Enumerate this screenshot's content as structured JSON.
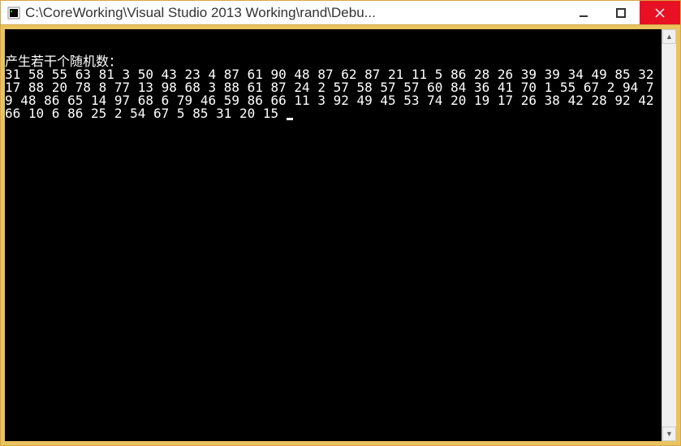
{
  "window": {
    "title": "C:\\CoreWorking\\Visual Studio 2013 Working\\rand\\Debu..."
  },
  "console": {
    "header": "产生若干个随机数：",
    "numbers": "31 58 55 63 81 3 50 43 23 4 87 61 90 48 87 62 87 21 11 5 86 28 26 39 39 34 49 85 32 17 88 20 78 8 77 13 98 68 3 88 61 87 24 2 57 58 57 57 60 84 36 41 70 1 55 67 2 94 79 48 86 65 14 97 68 6 79 46 59 86 66 11 3 92 49 45 53 74 20 19 17 26 38 42 28 92 42 66 10 6 86 25 2 54 67 5 85 31 20 15 "
  }
}
